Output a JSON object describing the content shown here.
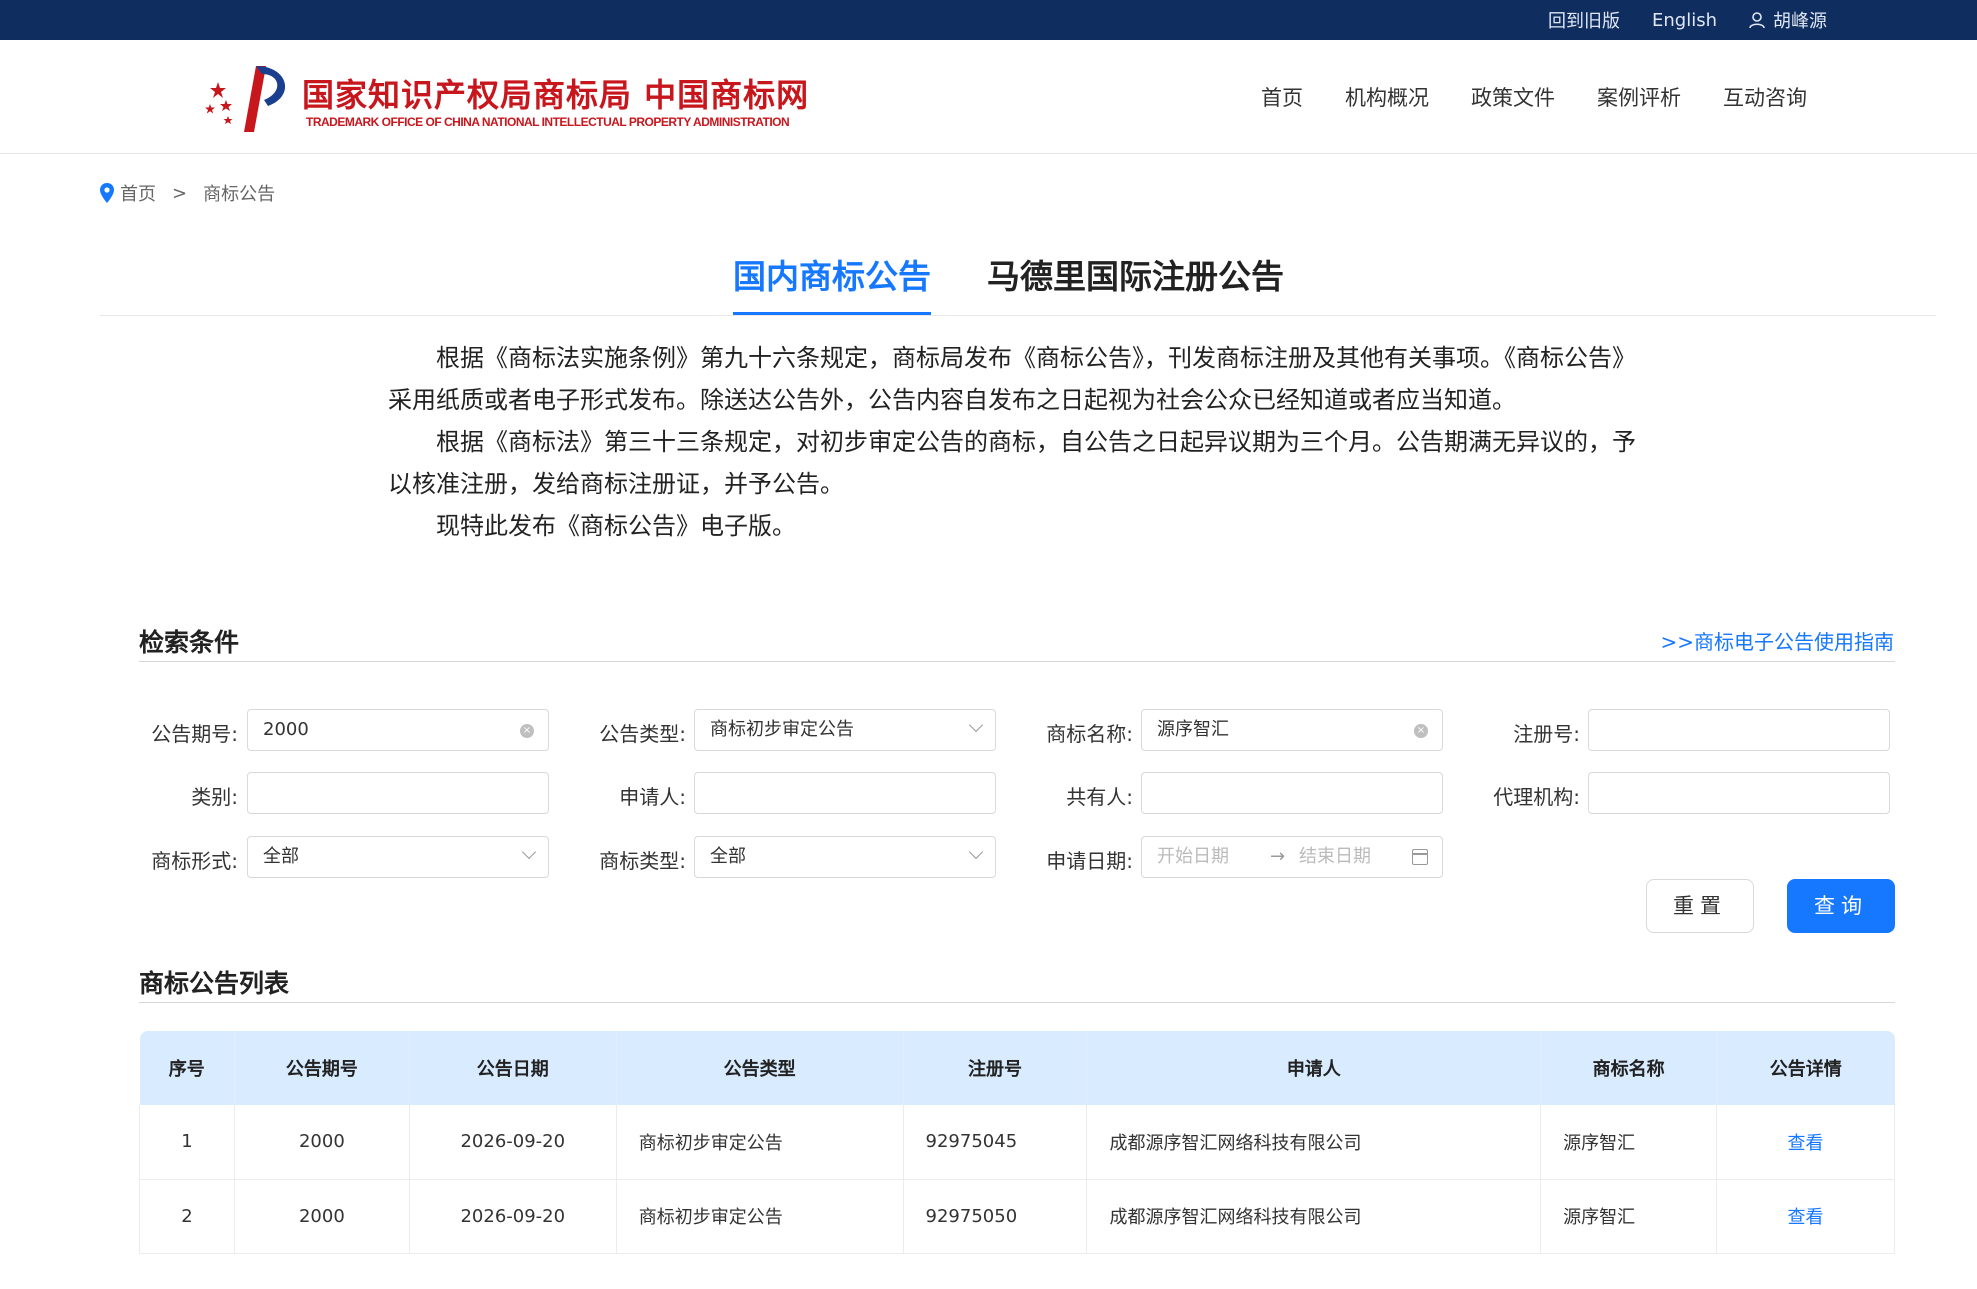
{
  "topbar": {
    "old_version": "回到旧版",
    "english": "English",
    "username": "胡峰源"
  },
  "header": {
    "logo_title": "国家知识产权局商标局 中国商标网",
    "logo_subtitle": "TRADEMARK OFFICE OF CHINA NATIONAL INTELLECTUAL PROPERTY ADMINISTRATION",
    "nav": [
      "首页",
      "机构概况",
      "政策文件",
      "案例评析",
      "互动咨询"
    ]
  },
  "breadcrumb": {
    "home": "首页",
    "separator": ">",
    "current": "商标公告"
  },
  "tabs": {
    "domestic": "国内商标公告",
    "madrid": "马德里国际注册公告"
  },
  "intro": {
    "p1": "根据《商标法实施条例》第九十六条规定，商标局发布《商标公告》，刊发商标注册及其他有关事项。《商标公告》采用纸质或者电子形式发布。除送达公告外，公告内容自发布之日起视为社会公众已经知道或者应当知道。",
    "p2": "根据《商标法》第三十三条规定，对初步审定公告的商标，自公告之日起异议期为三个月。公告期满无异议的，予以核准注册，发给商标注册证，并予公告。",
    "p3": "现特此发布《商标公告》电子版。"
  },
  "search": {
    "title": "检索条件",
    "guide_link": ">>商标电子公告使用指南",
    "issue_no_label": "公告期号:",
    "issue_no_value": "2000",
    "type_label": "公告类型:",
    "type_value": "商标初步审定公告",
    "mark_name_label": "商标名称:",
    "mark_name_value": "源序智汇",
    "reg_no_label": "注册号:",
    "class_label": "类别:",
    "applicant_label": "申请人:",
    "co_owner_label": "共有人:",
    "agency_label": "代理机构:",
    "mark_form_label": "商标形式:",
    "mark_form_value": "全部",
    "mark_type_label": "商标类型:",
    "mark_type_value": "全部",
    "apply_date_label": "申请日期:",
    "start_placeholder": "开始日期",
    "end_placeholder": "结束日期",
    "reset_button": "重置",
    "search_button": "查询"
  },
  "list": {
    "title": "商标公告列表",
    "columns": [
      "序号",
      "公告期号",
      "公告日期",
      "公告类型",
      "注册号",
      "申请人",
      "商标名称",
      "公告详情"
    ],
    "rows": [
      [
        "1",
        "2000",
        "2026-09-20",
        "商标初步审定公告",
        "92975045",
        "成都源序智汇网络科技有限公司",
        "源序智汇",
        "查看"
      ],
      [
        "2",
        "2000",
        "2026-09-20",
        "商标初步审定公告",
        "92975050",
        "成都源序智汇网络科技有限公司",
        "源序智汇",
        "查看"
      ]
    ]
  },
  "colors": {
    "topbar": "#0f2d5e",
    "accent": "#1677ff",
    "brand_red": "#c8161d",
    "table_header": "#d8ebff"
  }
}
